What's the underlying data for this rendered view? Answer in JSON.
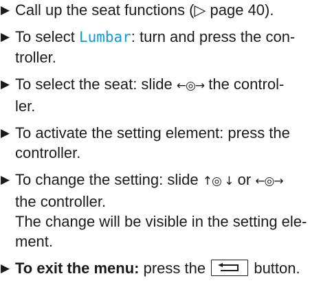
{
  "steps": [
    {
      "lines": [
        {
          "pre": "Call up the seat functions (",
          "ref": "▷ page 40",
          "post": ")."
        }
      ]
    },
    {
      "lines": [
        {
          "pre": "To select ",
          "hl": "Lumbar",
          "post": ": turn and press the con-"
        },
        {
          "text": "troller."
        }
      ]
    },
    {
      "lines": [
        {
          "pre": "To select the seat: slide ",
          "glyph": "←◎→",
          "post": " the control-"
        },
        {
          "text": "ler."
        }
      ]
    },
    {
      "lines": [
        {
          "text": "To activate the setting element: press the"
        },
        {
          "text": "controller."
        }
      ]
    },
    {
      "lines": [
        {
          "pre": "To change the setting: slide ",
          "glyph1": "↑◎ ↓",
          "mid": " or ",
          "glyph2": "←◎→"
        },
        {
          "text": "the controller."
        },
        {
          "text": "The change will be visible in the setting ele-"
        },
        {
          "text": "ment."
        }
      ]
    },
    {
      "lines": [
        {
          "bold": "To exit the menu:",
          "pre": " press the ",
          "post": " button."
        }
      ]
    }
  ],
  "icons": {
    "bullet": "triangle-bullet-icon",
    "back_key": "back-arrow-icon"
  },
  "colors": {
    "text": "#1a1a1a",
    "highlight": "#1497d3"
  }
}
